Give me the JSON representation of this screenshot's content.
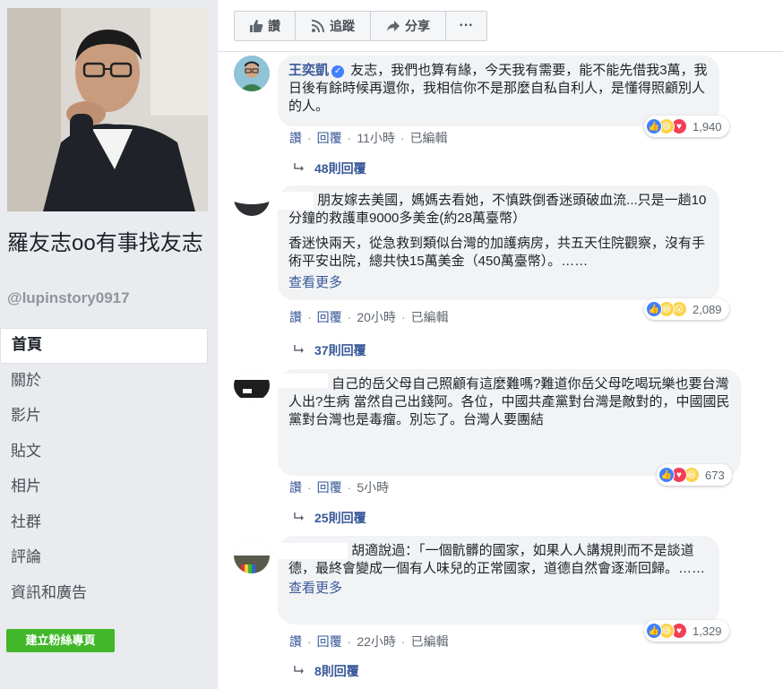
{
  "page": {
    "name": "羅友志oo有事找友志",
    "handle": "@lupinstory0917",
    "nav": [
      "首頁",
      "關於",
      "影片",
      "貼文",
      "相片",
      "社群",
      "評論",
      "資訊和廣告"
    ],
    "create_button": "建立粉絲專頁"
  },
  "actions": {
    "like": "讚",
    "follow": "追蹤",
    "share": "分享",
    "more": "···"
  },
  "comments": [
    {
      "author": "王奕凱",
      "verified": true,
      "paragraphs": [
        "友志，我們也算有緣，今天我有需要，能不能先借我3萬，我日後有餘時候再還你，我相信你不是那麼自私自利人，是懂得照顧別人的人。"
      ],
      "see_more": "",
      "like_label": "讚",
      "reply_label": "回覆",
      "time": "11小時",
      "edited": "已編輯",
      "reactions": [
        "like",
        "haha",
        "love"
      ],
      "reaction_count": "1,940",
      "replies": "48則回覆"
    },
    {
      "author": "",
      "verified": false,
      "paragraphs": [
        "朋友嫁去美國，媽媽去看她，不慎跌倒香迷頭破血流...只是一趟10分鐘的救護車9000多美金(約28萬臺幣）",
        "香迷快兩天，從急救到類似台灣的加護病房，共五天住院觀察，沒有手術平安出院，總共快15萬美金（450萬臺幣）。……"
      ],
      "see_more": "查看更多",
      "like_label": "讚",
      "reply_label": "回覆",
      "time": "20小時",
      "edited": "已編輯",
      "reactions": [
        "like",
        "haha",
        "wow"
      ],
      "reaction_count": "2,089",
      "replies": "37則回覆"
    },
    {
      "author": "",
      "verified": false,
      "paragraphs": [
        "自己的岳父母自己照顧有這麼難嗎?難道你岳父母吃喝玩樂也要台灣人出?生病 當然自己出錢阿。各位，中國共產黨對台灣是敵對的，中國國民黨對台灣也是毒瘤。別忘了。台灣人要團結"
      ],
      "see_more": "",
      "like_label": "讚",
      "reply_label": "回覆",
      "time": "5小時",
      "edited": "",
      "reactions": [
        "like",
        "love",
        "haha"
      ],
      "reaction_count": "673",
      "replies": "25則回覆"
    },
    {
      "author": "",
      "verified": false,
      "paragraphs": [
        "胡適說過：「一個骯髒的國家，如果人人講規則而不是談道德，最終會變成一個有人味兒的正常國家，道德自然會逐漸回歸。……"
      ],
      "see_more": "查看更多",
      "like_label": "讚",
      "reply_label": "回覆",
      "time": "22小時",
      "edited": "已編輯",
      "reactions": [
        "like",
        "haha",
        "love"
      ],
      "reaction_count": "1,329",
      "replies": "8則回覆"
    }
  ],
  "colors": {
    "link": "#385898",
    "green": "#42b72a",
    "bubble": "#f2f3f5",
    "background": "#e9ebee"
  }
}
